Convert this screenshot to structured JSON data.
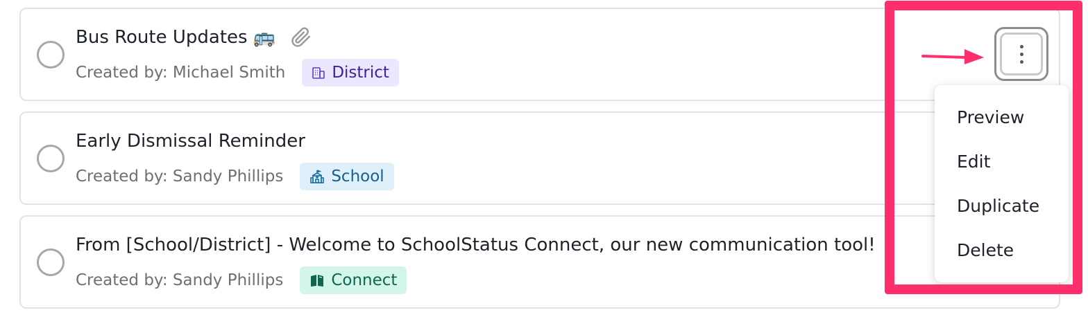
{
  "items": [
    {
      "title": "Bus Route Updates",
      "emoji": "🚌",
      "has_attachment": true,
      "creator": "Created by: Michael Smith",
      "tag": "District"
    },
    {
      "title": "Early Dismissal Reminder",
      "creator": "Created by: Sandy Phillips",
      "tag": "School"
    },
    {
      "title": "From [School/District] - Welcome to SchoolStatus Connect, our new communication tool!",
      "creator": "Created by: Sandy Phillips",
      "tag": "Connect"
    }
  ],
  "menu": {
    "items": [
      "Preview",
      "Edit",
      "Duplicate",
      "Delete"
    ]
  },
  "colors": {
    "highlight": "#ff2f6d",
    "district_tag_bg": "#ece6ff",
    "school_tag_bg": "#dff0fb",
    "connect_tag_bg": "#d4f6ea"
  },
  "icons": {
    "attachment": "paperclip-icon",
    "district": "building-icon",
    "school": "school-icon",
    "connect": "book-icon",
    "more": "kebab-menu-icon"
  }
}
